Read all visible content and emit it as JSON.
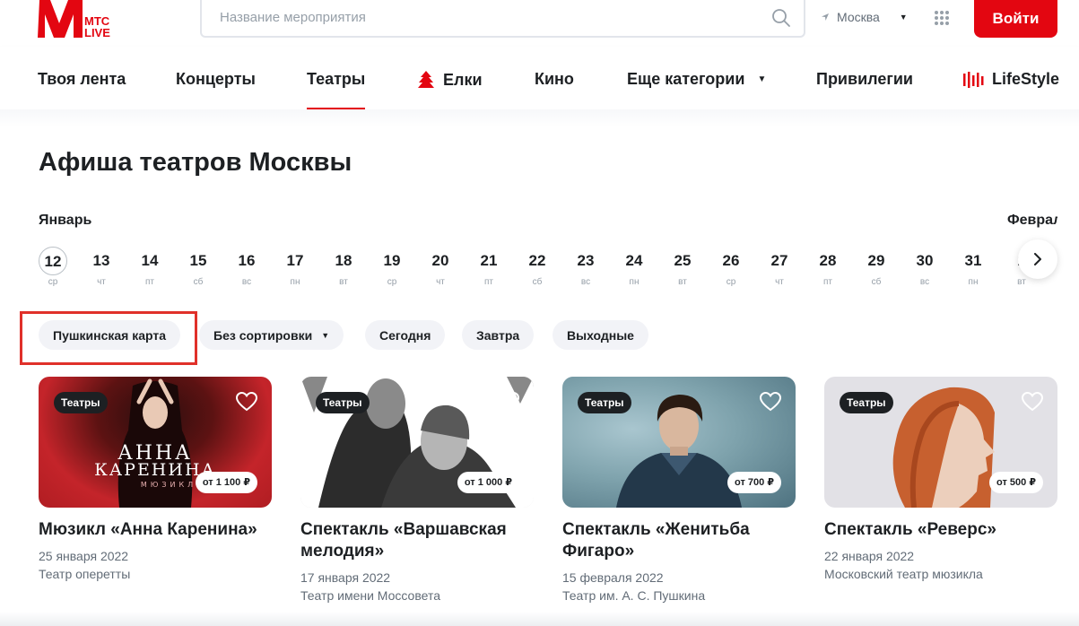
{
  "header": {
    "logo_text_1": "МТС",
    "logo_text_2": "LIVE",
    "search_placeholder": "Название мероприятия",
    "city": "Москва",
    "login_label": "Войти"
  },
  "nav": {
    "items": [
      "Твоя лента",
      "Концерты",
      "Театры",
      "Елки",
      "Кино",
      "Еще категории",
      "Привилегии",
      "LifeStyle"
    ],
    "active": "Театры"
  },
  "page_title": "Афиша театров Москвы",
  "calendar": {
    "month_current": "Январь",
    "month_next": "Февраль",
    "selected": "12",
    "dates": [
      {
        "num": "12",
        "dow": "ср"
      },
      {
        "num": "13",
        "dow": "чт"
      },
      {
        "num": "14",
        "dow": "пт"
      },
      {
        "num": "15",
        "dow": "сб"
      },
      {
        "num": "16",
        "dow": "вс"
      },
      {
        "num": "17",
        "dow": "пн"
      },
      {
        "num": "18",
        "dow": "вт"
      },
      {
        "num": "19",
        "dow": "ср"
      },
      {
        "num": "20",
        "dow": "чт"
      },
      {
        "num": "21",
        "dow": "пт"
      },
      {
        "num": "22",
        "dow": "сб"
      },
      {
        "num": "23",
        "dow": "вс"
      },
      {
        "num": "24",
        "dow": "пн"
      },
      {
        "num": "25",
        "dow": "вт"
      },
      {
        "num": "26",
        "dow": "ср"
      },
      {
        "num": "27",
        "dow": "чт"
      },
      {
        "num": "28",
        "dow": "пт"
      },
      {
        "num": "29",
        "dow": "сб"
      },
      {
        "num": "30",
        "dow": "вс"
      },
      {
        "num": "31",
        "dow": "пн"
      },
      {
        "num": "1",
        "dow": "вт"
      }
    ]
  },
  "filters": [
    "Пушкинская карта",
    "Без сортировки",
    "Сегодня",
    "Завтра",
    "Выходные"
  ],
  "cards": [
    {
      "badge": "Театры",
      "price": "от 1 100 ₽",
      "title": "Мюзикл «Анна Каренина»",
      "date": "25 января 2022",
      "venue": "Театр оперетты",
      "poster_text_1": "АННА",
      "poster_text_2": "КАРЕНИНА",
      "poster_text_3": "МЮЗИКЛ"
    },
    {
      "badge": "Театры",
      "price": "от 1 000 ₽",
      "title": "Спектакль «Варшавская мелодия»",
      "date": "17 января 2022",
      "venue": "Театр имени Моссовета"
    },
    {
      "badge": "Театры",
      "price": "от 700 ₽",
      "title": "Спектакль «Женитьба Фигаро»",
      "date": "15 февраля 2022",
      "venue": "Театр им. А. С. Пушкина"
    },
    {
      "badge": "Театры",
      "price": "от 500 ₽",
      "title": "Спектакль «Реверс»",
      "date": "22 января 2022",
      "venue": "Московский театр мюзикла"
    }
  ],
  "colors": {
    "brand_red": "#e30611",
    "text": "#1d2023",
    "muted": "#626c77",
    "chip_bg": "#f2f3f7"
  }
}
